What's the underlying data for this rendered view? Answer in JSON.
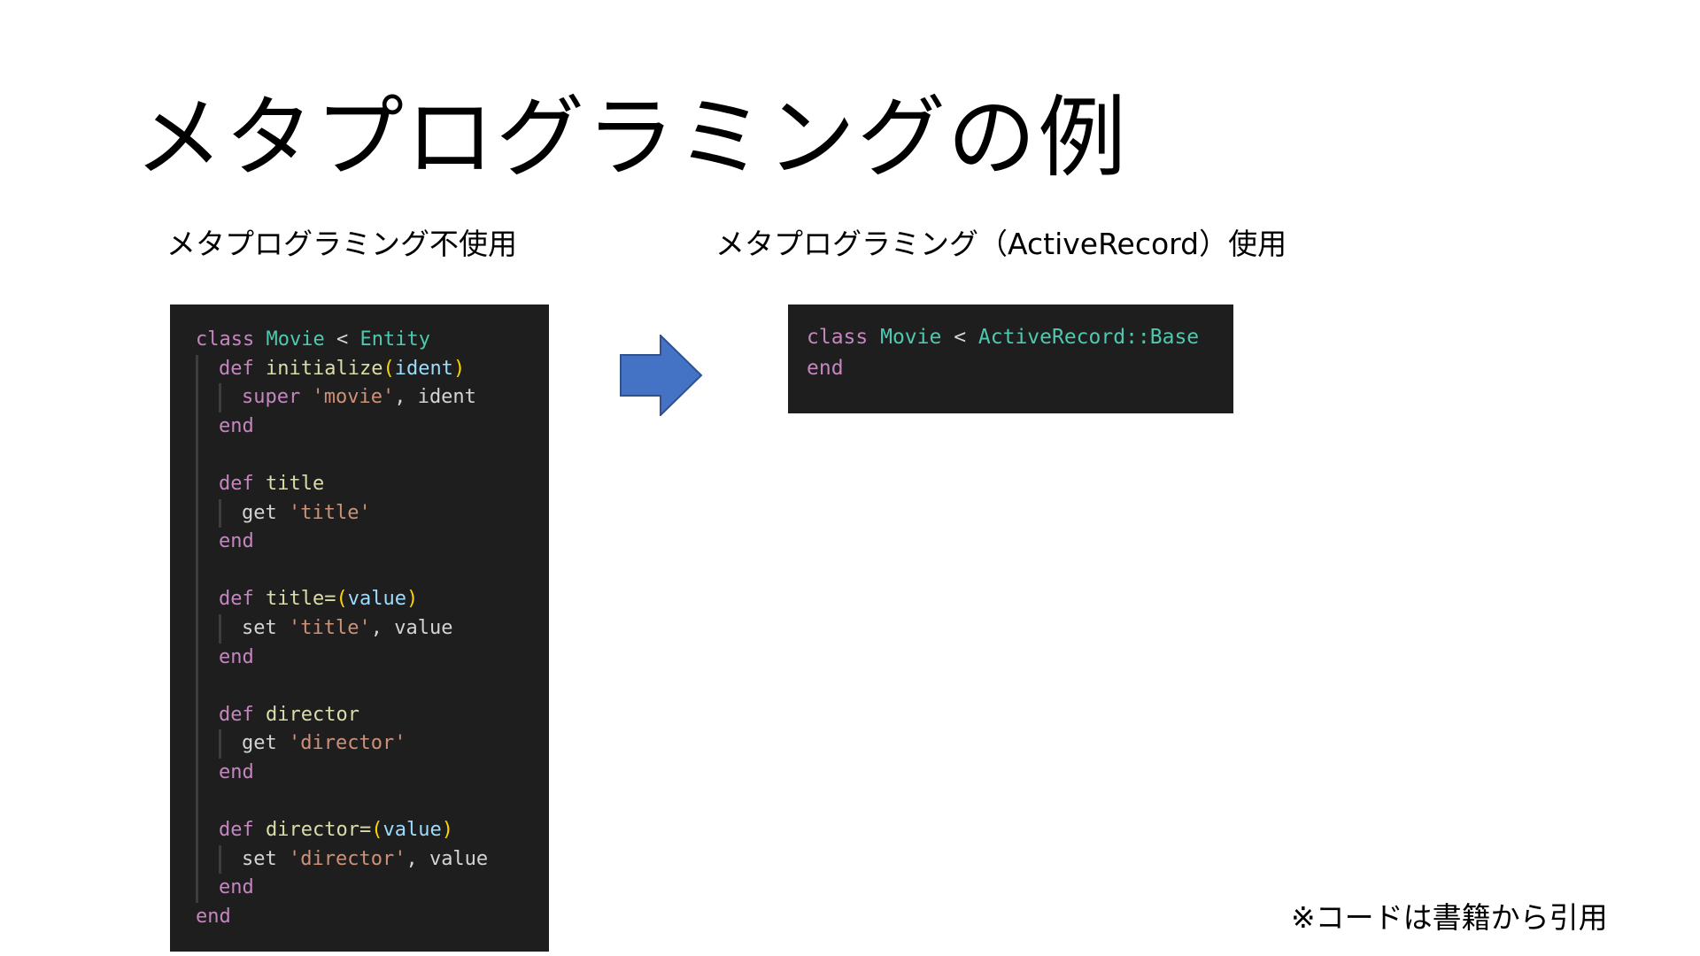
{
  "title": "メタプログラミングの例",
  "left_heading": "メタプログラミング不使用",
  "right_heading": "メタプログラミング（ActiveRecord）使用",
  "footnote": "※コードは書籍から引用",
  "colors": {
    "code_background": "#1e1e1e",
    "arrow_fill": "#4472c4",
    "keyword": "#c586c0",
    "class_name": "#4ec9b0",
    "string": "#ce9178"
  },
  "icons": {
    "arrow": "right-arrow-icon"
  },
  "code_left": {
    "l1": {
      "kw": "class",
      "name": "Movie",
      "op": " < ",
      "parent": "Entity"
    },
    "l2": {
      "kw": "def",
      "fn": "initialize",
      "open": "(",
      "param": "ident",
      "close": ")"
    },
    "l3": {
      "call": "super",
      "str": "'movie'",
      "rest": ", ident"
    },
    "l4": {
      "kw": "end"
    },
    "l5": {
      "kw": "def",
      "fn": "title"
    },
    "l6": {
      "call": "get",
      "str": "'title'"
    },
    "l7": {
      "kw": "end"
    },
    "l8": {
      "kw": "def",
      "fn": "title=",
      "open": "(",
      "param": "value",
      "close": ")"
    },
    "l9": {
      "call": "set",
      "str": "'title'",
      "rest": ", value"
    },
    "l10": {
      "kw": "end"
    },
    "l11": {
      "kw": "def",
      "fn": "director"
    },
    "l12": {
      "call": "get",
      "str": "'director'"
    },
    "l13": {
      "kw": "end"
    },
    "l14": {
      "kw": "def",
      "fn": "director=",
      "open": "(",
      "param": "value",
      "close": ")"
    },
    "l15": {
      "call": "set",
      "str": "'director'",
      "rest": ", value"
    },
    "l16": {
      "kw": "end"
    },
    "l17": {
      "kw": "end"
    }
  },
  "code_right": {
    "l1": {
      "kw": "class",
      "name": "Movie",
      "op": " < ",
      "parent": "ActiveRecord::Base"
    },
    "l2": {
      "kw": "end"
    }
  }
}
